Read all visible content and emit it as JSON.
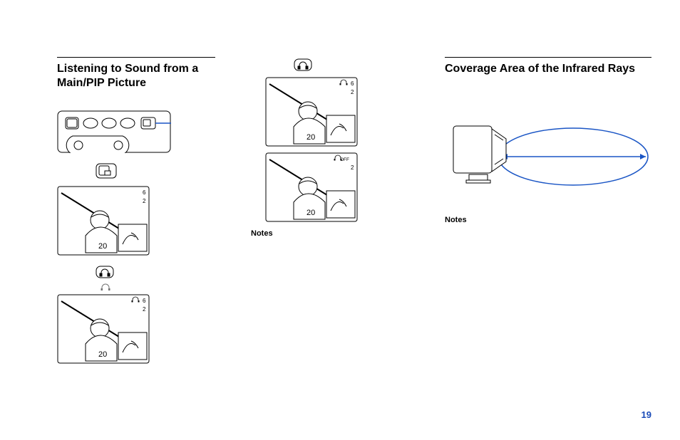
{
  "left": {
    "heading": "Listening to Sound from a Main/PIP Picture",
    "osd1": {
      "channel": "6",
      "sub": "2",
      "jersey": "20"
    },
    "osd2": {
      "channel": "6",
      "sub": "2",
      "jersey": "20"
    }
  },
  "middle": {
    "osd1": {
      "channel": "6",
      "sub": "2",
      "jersey": "20"
    },
    "osd2": {
      "off": "OFF",
      "sub": "2",
      "jersey": "20"
    },
    "notes": "Notes"
  },
  "right": {
    "heading": "Coverage Area of the Infrared Rays",
    "notes": "Notes"
  },
  "page_number": "19"
}
